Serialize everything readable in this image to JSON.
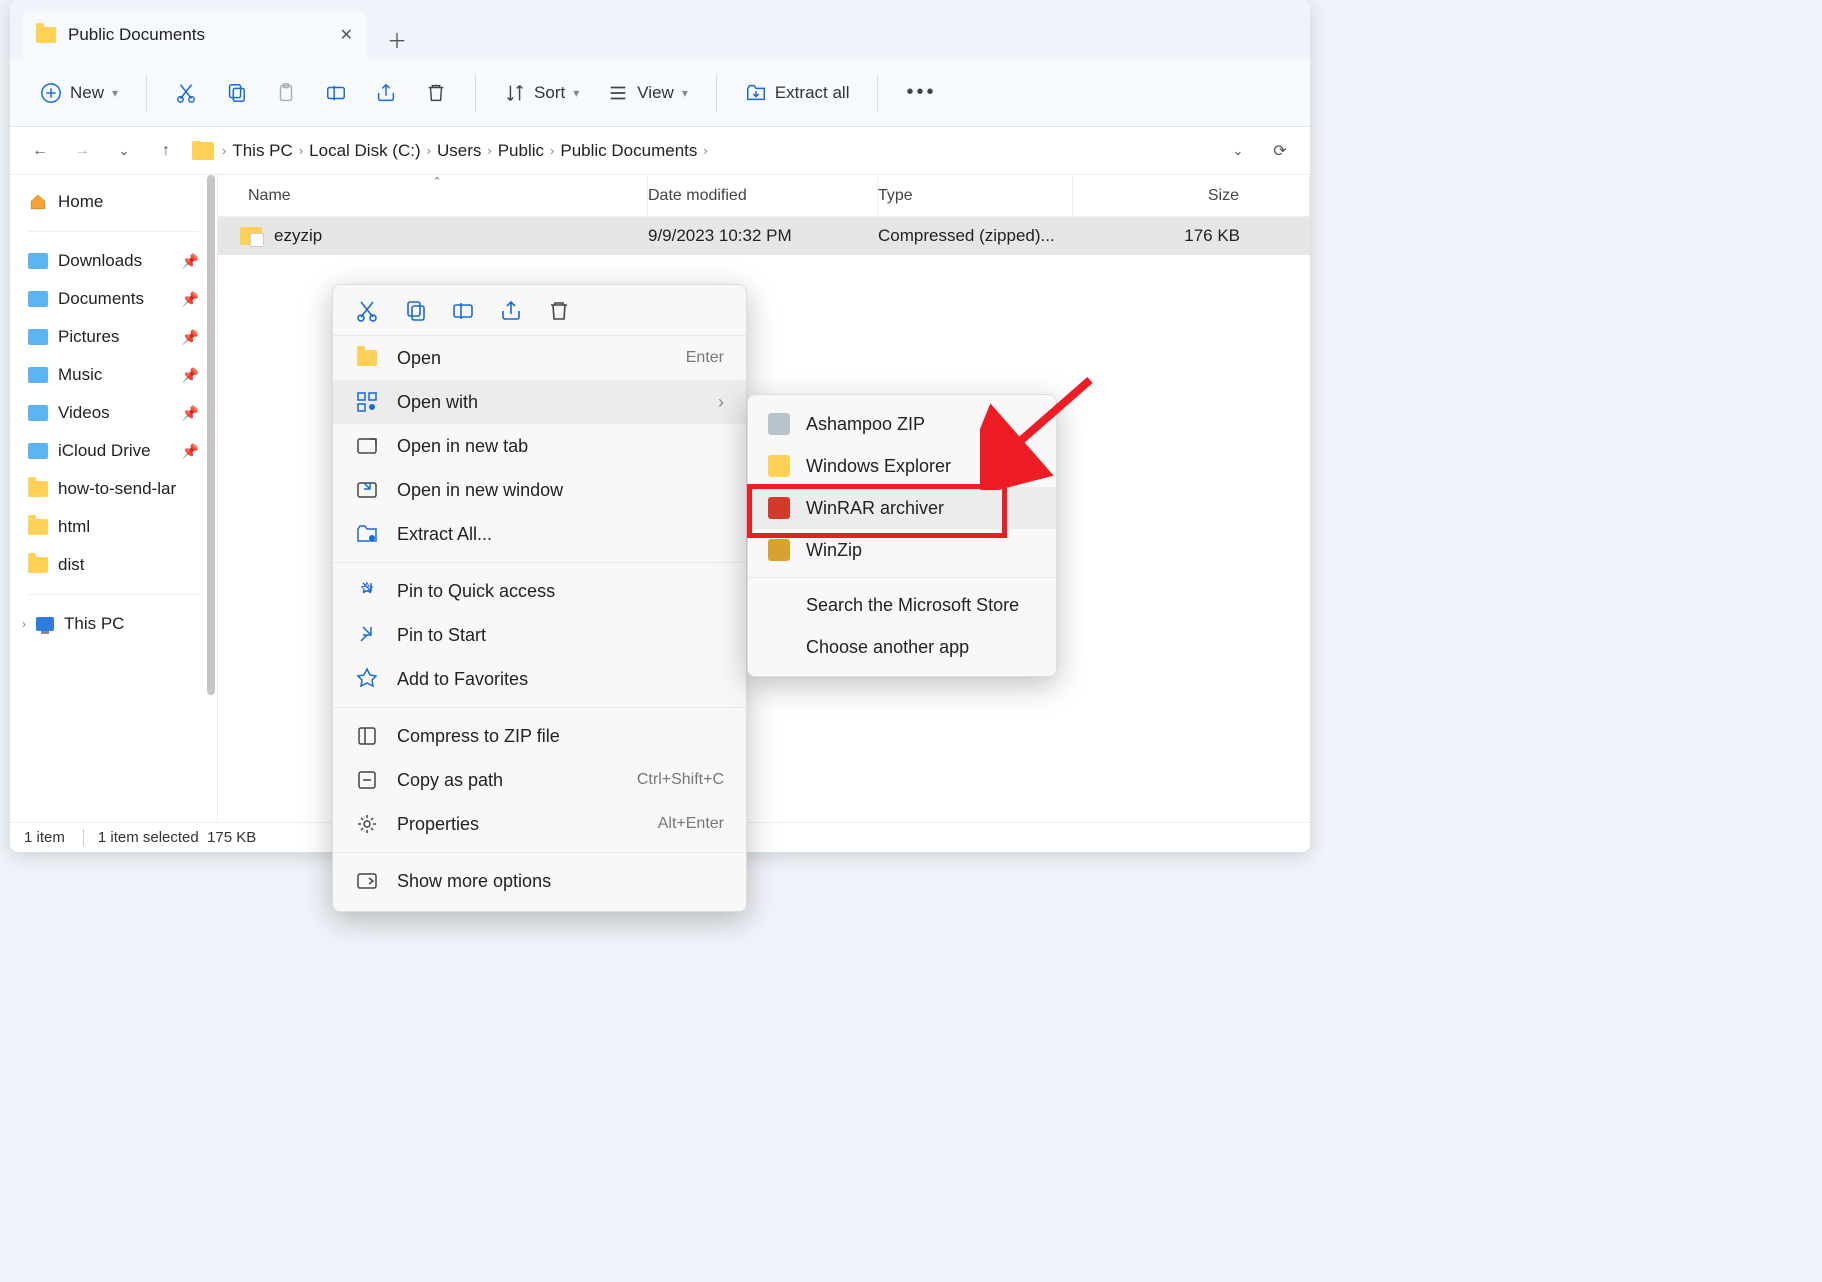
{
  "tab_title": "Public Documents",
  "toolbar": {
    "new": "New",
    "sort": "Sort",
    "view": "View",
    "extract_all": "Extract all"
  },
  "breadcrumb": [
    "This PC",
    "Local Disk (C:)",
    "Users",
    "Public",
    "Public Documents"
  ],
  "sidebar": {
    "home": "Home",
    "items": [
      {
        "label": "Downloads",
        "pin": true,
        "color": "b"
      },
      {
        "label": "Documents",
        "pin": true,
        "color": "b"
      },
      {
        "label": "Pictures",
        "pin": true,
        "color": "b"
      },
      {
        "label": "Music",
        "pin": true,
        "color": "b"
      },
      {
        "label": "Videos",
        "pin": true,
        "color": "b"
      },
      {
        "label": "iCloud Drive",
        "pin": true,
        "color": "b"
      },
      {
        "label": "how-to-send-lar",
        "pin": false,
        "color": "y"
      },
      {
        "label": "html",
        "pin": false,
        "color": "y"
      },
      {
        "label": "dist",
        "pin": false,
        "color": "y"
      }
    ],
    "this_pc": "This PC"
  },
  "columns": {
    "name": "Name",
    "date": "Date modified",
    "type": "Type",
    "size": "Size"
  },
  "files": [
    {
      "name": "ezyzip",
      "date": "9/9/2023 10:32 PM",
      "type": "Compressed (zipped)...",
      "size": "176 KB"
    }
  ],
  "status": {
    "count": "1 item",
    "selected": "1 item selected",
    "size": "175 KB"
  },
  "context": {
    "open": "Open",
    "open_sc": "Enter",
    "open_with": "Open with",
    "open_tab": "Open in new tab",
    "open_window": "Open in new window",
    "extract": "Extract All...",
    "pin_quick": "Pin to Quick access",
    "pin_start": "Pin to Start",
    "fav": "Add to Favorites",
    "compress": "Compress to ZIP file",
    "copy_path": "Copy as path",
    "copy_path_sc": "Ctrl+Shift+C",
    "properties": "Properties",
    "properties_sc": "Alt+Enter",
    "more": "Show more options"
  },
  "openwith": [
    {
      "label": "Ashampoo ZIP",
      "color": "#b8c4cf"
    },
    {
      "label": "Windows Explorer",
      "color": "#ffd257"
    },
    {
      "label": "WinRAR archiver",
      "color": "#d43a2a"
    },
    {
      "label": "WinZip",
      "color": "#d8a22e"
    },
    {
      "label": "Search the Microsoft Store",
      "color": ""
    },
    {
      "label": "Choose another app",
      "color": ""
    }
  ]
}
